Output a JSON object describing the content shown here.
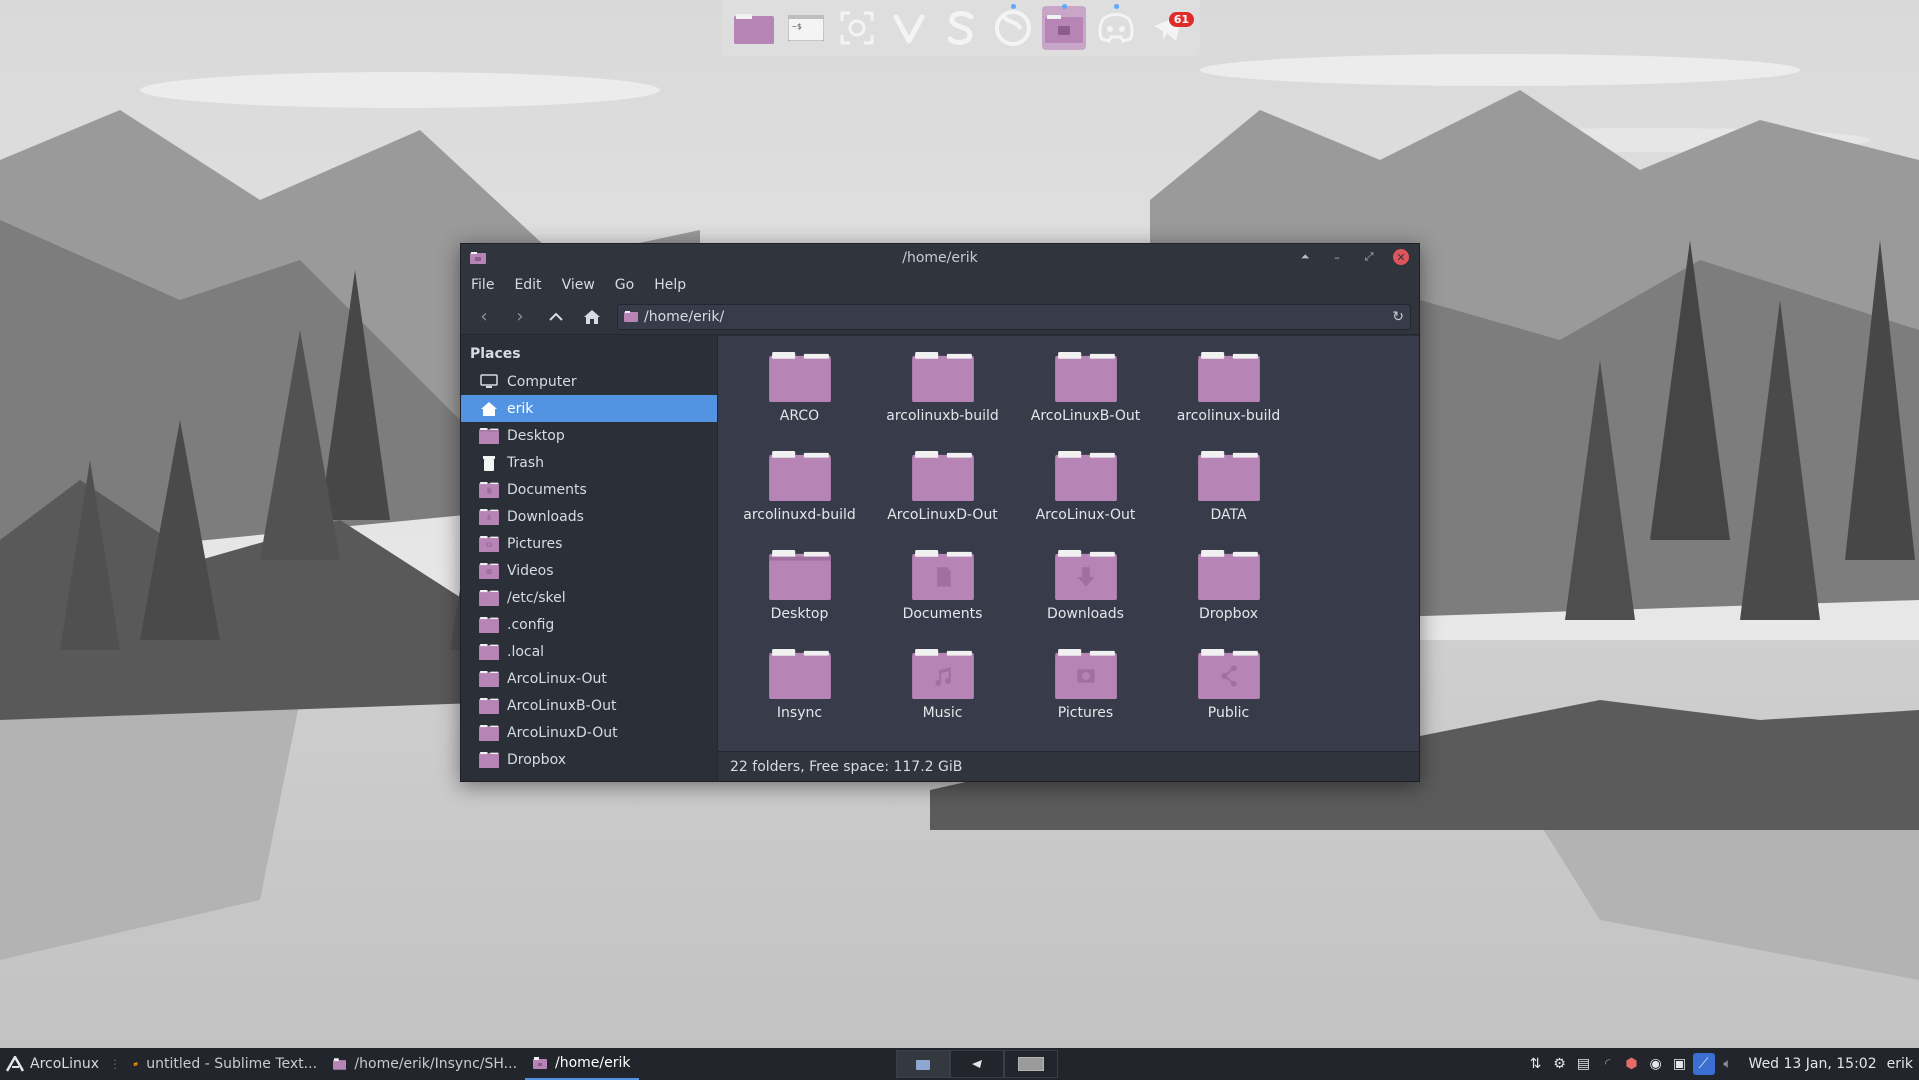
{
  "dock": {
    "items": [
      {
        "icon": "folder-icon"
      },
      {
        "icon": "terminal-icon"
      },
      {
        "icon": "screenshot-icon"
      },
      {
        "icon": "vivaldi-icon"
      },
      {
        "icon": "sublime-icon"
      },
      {
        "icon": "firefox-icon"
      },
      {
        "icon": "camera-folder-icon"
      },
      {
        "icon": "discord-icon"
      },
      {
        "icon": "telegram-icon",
        "badge": "61"
      }
    ]
  },
  "window": {
    "title": "/home/erik",
    "menu": [
      "File",
      "Edit",
      "View",
      "Go",
      "Help"
    ],
    "path": "/home/erik/",
    "places_title": "Places",
    "places": [
      {
        "label": "Computer",
        "icon": "computer-icon"
      },
      {
        "label": "erik",
        "icon": "home-icon",
        "selected": true
      },
      {
        "label": "Desktop",
        "icon": "desktop-folder-icon"
      },
      {
        "label": "Trash",
        "icon": "trash-icon"
      },
      {
        "label": "Documents",
        "icon": "documents-folder-icon"
      },
      {
        "label": "Downloads",
        "icon": "downloads-folder-icon"
      },
      {
        "label": "Pictures",
        "icon": "pictures-folder-icon"
      },
      {
        "label": "Videos",
        "icon": "videos-folder-icon"
      },
      {
        "label": "/etc/skel",
        "icon": "folder-icon"
      },
      {
        "label": ".config",
        "icon": "folder-icon"
      },
      {
        "label": ".local",
        "icon": "folder-icon"
      },
      {
        "label": "ArcoLinux-Out",
        "icon": "folder-icon"
      },
      {
        "label": "ArcoLinuxB-Out",
        "icon": "folder-icon"
      },
      {
        "label": "ArcoLinuxD-Out",
        "icon": "folder-icon"
      },
      {
        "label": "Dropbox",
        "icon": "folder-icon"
      }
    ],
    "folders": [
      {
        "label": "ARCO",
        "icon": "folder-icon"
      },
      {
        "label": "arcolinuxb-build",
        "icon": "folder-icon"
      },
      {
        "label": "ArcoLinuxB-Out",
        "icon": "folder-icon"
      },
      {
        "label": "arcolinux-build",
        "icon": "folder-icon"
      },
      {
        "label": "arcolinuxd-build",
        "icon": "folder-icon"
      },
      {
        "label": "ArcoLinuxD-Out",
        "icon": "folder-icon"
      },
      {
        "label": "ArcoLinux-Out",
        "icon": "folder-icon"
      },
      {
        "label": "DATA",
        "icon": "folder-icon"
      },
      {
        "label": "Desktop",
        "icon": "desktop-folder-icon"
      },
      {
        "label": "Documents",
        "icon": "documents-folder-icon"
      },
      {
        "label": "Downloads",
        "icon": "downloads-folder-icon"
      },
      {
        "label": "Dropbox",
        "icon": "folder-icon"
      },
      {
        "label": "Insync",
        "icon": "folder-icon"
      },
      {
        "label": "Music",
        "icon": "music-folder-icon"
      },
      {
        "label": "Pictures",
        "icon": "pictures-folder-icon"
      },
      {
        "label": "Public",
        "icon": "public-folder-icon"
      }
    ],
    "status": "22 folders, Free space: 117.2 GiB"
  },
  "panel": {
    "start_label": "ArcoLinux",
    "tasks": [
      {
        "label": "untitled - Sublime Text...",
        "icon": "sublime-icon"
      },
      {
        "label": "/home/erik/Insync/SH...",
        "icon": "folder-icon"
      },
      {
        "label": "/home/erik",
        "icon": "camera-folder-icon",
        "active": true
      }
    ],
    "tray_icons": [
      "network-icon",
      "gear-icon",
      "clipboard-icon",
      "wifi-icon",
      "toolbox-icon",
      "discord-icon",
      "screenshot-tray-icon",
      "vpn-icon",
      "volume-icon"
    ],
    "clock": "Wed 13 Jan, 15:02",
    "user": "erik"
  },
  "colors": {
    "folder": "#b784b6",
    "folder_dark": "#a070a0",
    "folder_tab": "#f1f1f1",
    "selection": "#5294e2",
    "window_bg": "#383c4a",
    "panel_bg": "#22252b"
  }
}
